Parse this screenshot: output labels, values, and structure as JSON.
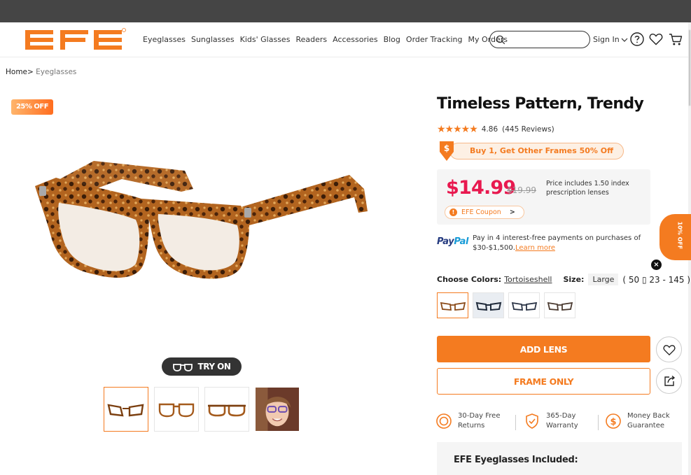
{
  "brand": {
    "logo_text": "EFE",
    "accent": "#f47b20",
    "price_color": "#e8194f"
  },
  "nav": {
    "items": [
      "Eyeglasses",
      "Sunglasses",
      "Kids' Glasses",
      "Readers",
      "Accessories",
      "Blog",
      "Order Tracking",
      "My Orders"
    ]
  },
  "search": {
    "placeholder": "",
    "value": ""
  },
  "account": {
    "signin_label": "Sign In"
  },
  "header_icons": [
    "help-icon",
    "heart-icon",
    "cart-icon"
  ],
  "breadcrumb": {
    "home": "Home",
    "separator": ">",
    "current": "Eyeglasses"
  },
  "product": {
    "discount_badge": "25% OFF",
    "title": "Timeless Pattern, Trendy",
    "rating": {
      "stars": "★★★★★",
      "value": "4.86",
      "reviews": "(445 Reviews)"
    },
    "promo": "Buy 1, Get Other Frames 50% Off",
    "price": "$14.99",
    "old_price": "$19.99",
    "price_note": "Price includes 1.50 index prescription lenses",
    "coupon": "EFE Coupon",
    "coupon_arrow": ">",
    "paypal": {
      "logo_part1": "Pay",
      "logo_part2": "Pal",
      "text": "Pay in 4 interest-free payments on purchases of $30-$1,500.",
      "link": "Learn more"
    },
    "choose_colors_label": "Choose Colors:",
    "selected_color": "Tortoiseshell",
    "size_label": "Size:",
    "size_value": "Large",
    "size_dims": "( 50 ▯ 23 - 145 )",
    "add_lens": "ADD LENS",
    "frame_only": "FRAME ONLY",
    "try_on": "TRY ON",
    "perks": [
      {
        "line1": "30-Day Free",
        "line2": "Returns",
        "icon": "return-icon"
      },
      {
        "line1": "365-Day",
        "line2": "Warranty",
        "icon": "shield-check-icon"
      },
      {
        "line1": "Money Back",
        "line2": "Guarantee",
        "icon": "dollar-icon"
      }
    ],
    "included_title": "EFE Eyeglasses Included:"
  },
  "side_tab": {
    "label": "10% OFF"
  }
}
